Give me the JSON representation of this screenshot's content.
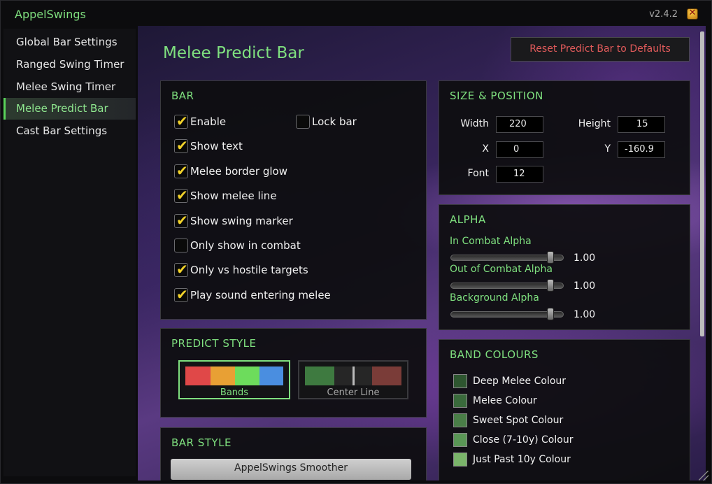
{
  "app": {
    "title": "AppelSwings",
    "version": "v2.4.2"
  },
  "sidebar": {
    "items": [
      {
        "label": "Global Bar Settings"
      },
      {
        "label": "Ranged Swing Timer"
      },
      {
        "label": "Melee Swing Timer"
      },
      {
        "label": "Melee Predict Bar",
        "active": true
      },
      {
        "label": "Cast Bar Settings"
      }
    ]
  },
  "page": {
    "title": "Melee Predict Bar",
    "reset_label": "Reset Predict Bar to Defaults"
  },
  "bar": {
    "title": "BAR",
    "options": [
      {
        "label": "Enable",
        "checked": true
      },
      {
        "label": "Lock bar",
        "checked": false
      },
      {
        "label": "Show text",
        "checked": true
      },
      {
        "label": "Melee border glow",
        "checked": true
      },
      {
        "label": "Show melee line",
        "checked": true
      },
      {
        "label": "Show swing marker",
        "checked": true
      },
      {
        "label": "Only show in combat",
        "checked": false
      },
      {
        "label": "Only vs hostile targets",
        "checked": true
      },
      {
        "label": "Play sound entering melee",
        "checked": true
      }
    ]
  },
  "size": {
    "title": "SIZE & POSITION",
    "width_label": "Width",
    "width": "220",
    "height_label": "Height",
    "height": "15",
    "x_label": "X",
    "x": "0",
    "y_label": "Y",
    "y": "-160.9",
    "font_label": "Font",
    "font": "12"
  },
  "alpha": {
    "title": "ALPHA",
    "sliders": [
      {
        "label": "In Combat Alpha",
        "value": "1.00",
        "fraction": 1.0
      },
      {
        "label": "Out of Combat Alpha",
        "value": "1.00",
        "fraction": 1.0
      },
      {
        "label": "Background Alpha",
        "value": "1.00",
        "fraction": 1.0
      }
    ]
  },
  "predict": {
    "title": "PREDICT STYLE",
    "styles": [
      {
        "label": "Bands",
        "selected": true,
        "colors": [
          "#e04848",
          "#e8a034",
          "#6ddc5c",
          "#4a8ee0"
        ]
      },
      {
        "label": "Center Line",
        "selected": false,
        "colors": [
          "#3e7a40",
          "#262626",
          "#262626",
          "#7a3c38"
        ]
      }
    ]
  },
  "bands": {
    "title": "BAND COLOURS",
    "items": [
      {
        "label": "Deep Melee Colour",
        "color": "#2e5630"
      },
      {
        "label": "Melee Colour",
        "color": "#3a6a3c"
      },
      {
        "label": "Sweet Spot Colour",
        "color": "#4a7e48"
      },
      {
        "label": "Close (7-10y) Colour",
        "color": "#5a9656"
      },
      {
        "label": "Just Past 10y Colour",
        "color": "#7ab46a"
      }
    ]
  },
  "barstyle": {
    "title": "BAR STYLE",
    "selected": "AppelSwings Smoother"
  }
}
